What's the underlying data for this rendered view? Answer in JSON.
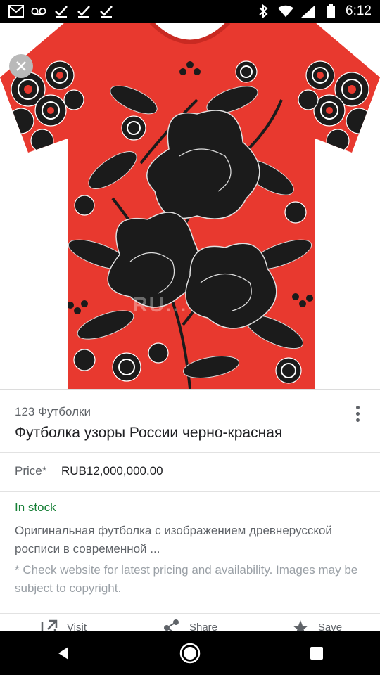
{
  "status_bar": {
    "time": "6:12",
    "left_icons": [
      "gmail-icon",
      "voicemail-icon",
      "check-icon",
      "check-icon",
      "check-icon"
    ],
    "right_icons": [
      "bluetooth-icon",
      "wifi-icon",
      "signal-icon",
      "battery-icon"
    ]
  },
  "product_image": {
    "watermark": "RU..."
  },
  "product": {
    "store": "123 Футболки",
    "title": "Футболка узоры России черно-красная",
    "price_label": "Price*",
    "price_value": "RUB12,000,000.00",
    "stock_status": "In stock",
    "description": "Оригинальная футболка с изображением древнерусской росписи в современной ...",
    "disclaimer": "* Check website for latest pricing and availability. Images may be subject to copyright."
  },
  "actions": [
    {
      "icon": "open-in-new-icon",
      "label": "Visit"
    },
    {
      "icon": "share-icon",
      "label": "Share"
    },
    {
      "icon": "save-icon",
      "label": "Save"
    }
  ],
  "colors": {
    "shirt_red": "#e8392f",
    "pattern_black": "#1b1b1b",
    "in_stock_green": "#188038"
  }
}
